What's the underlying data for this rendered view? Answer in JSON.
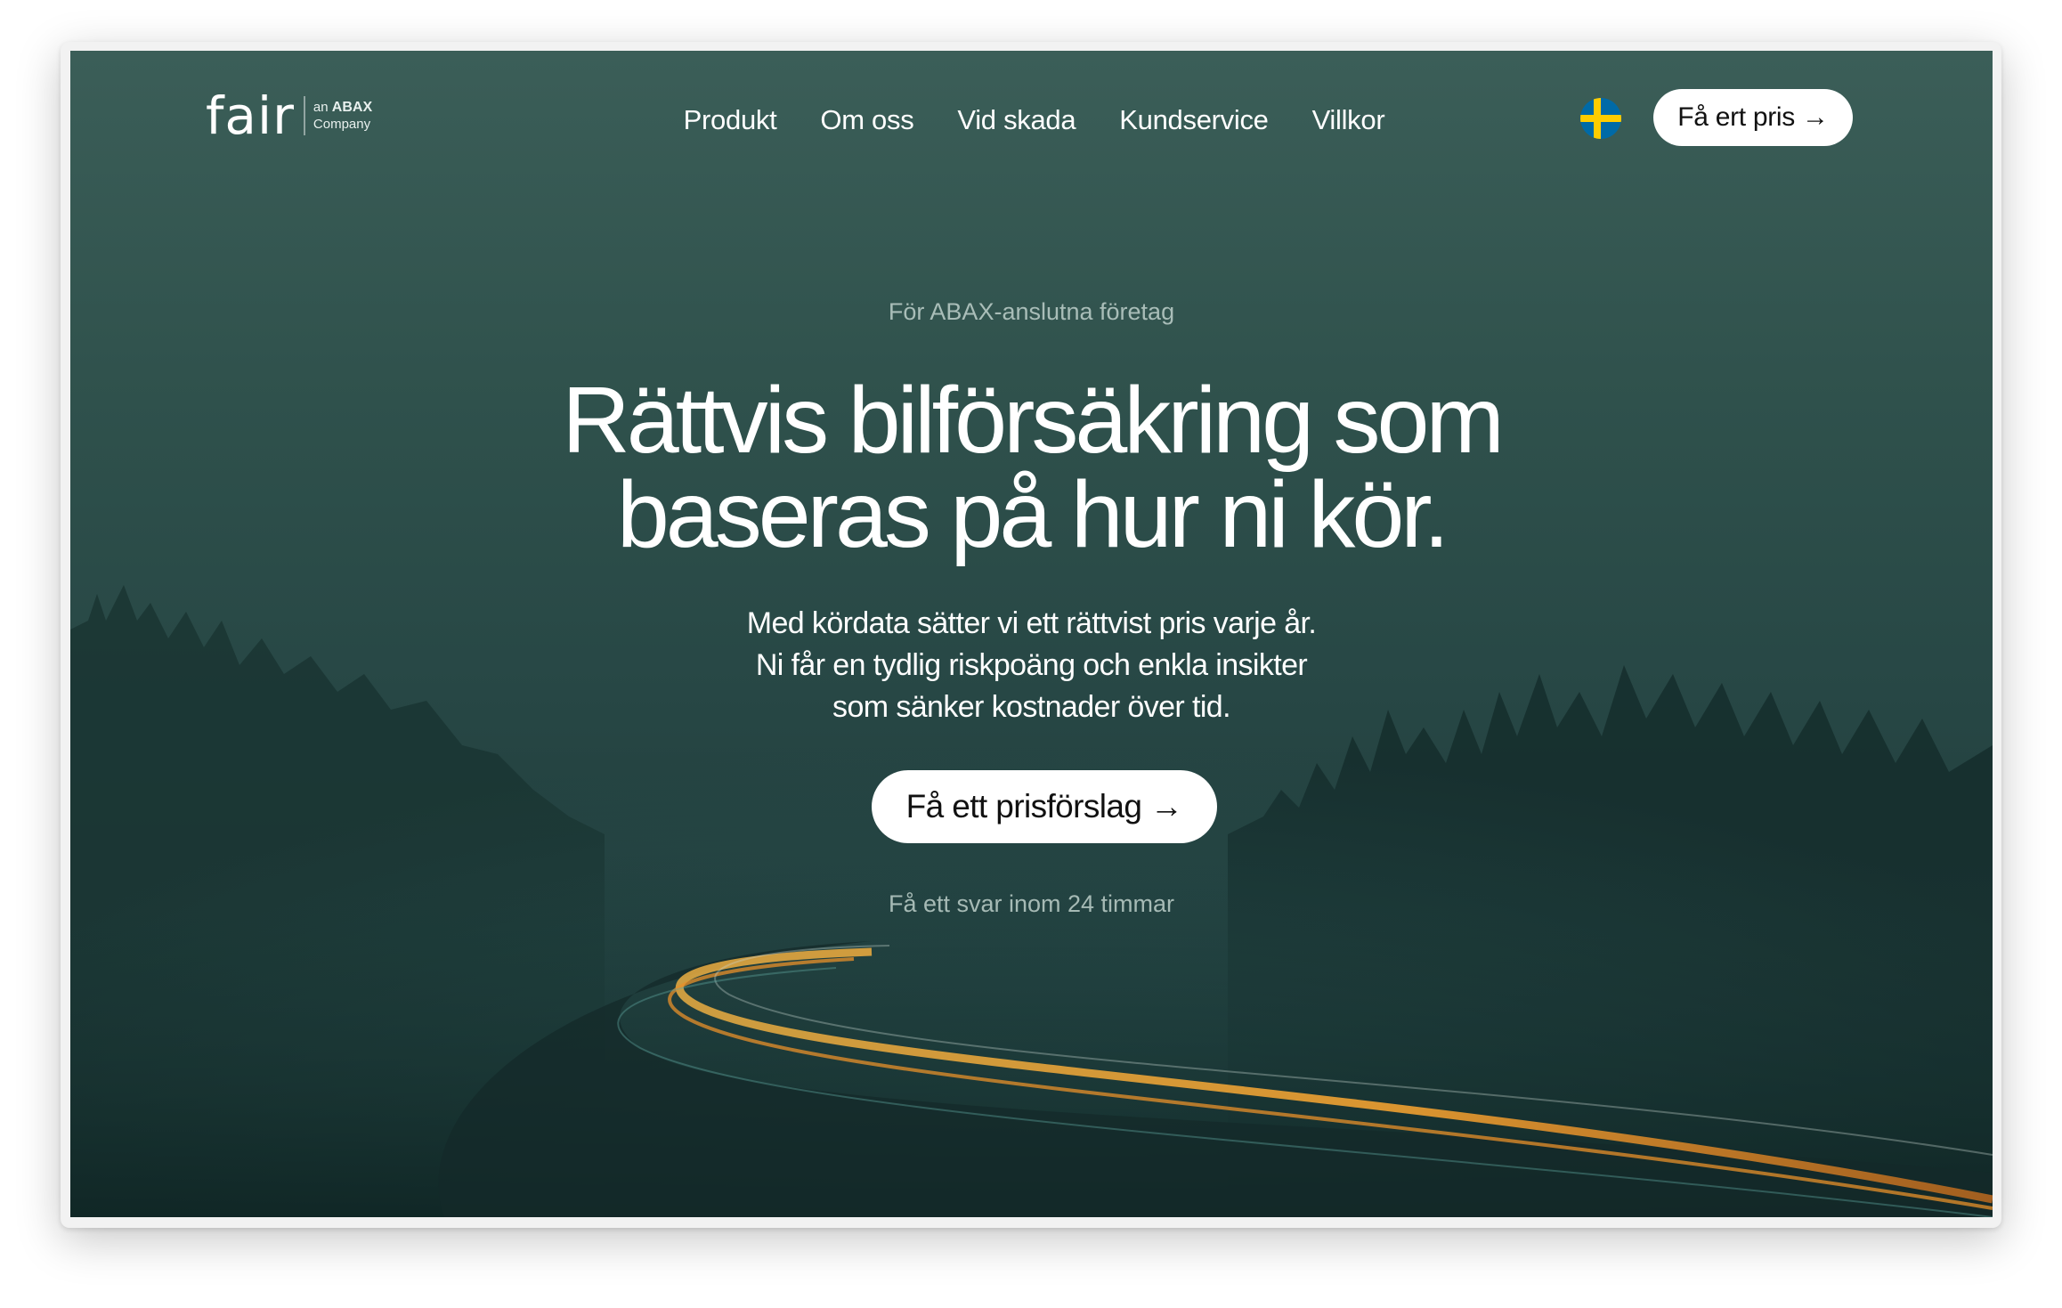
{
  "brand": {
    "logo": "fair",
    "sub_prefix": "an",
    "sub_brand": "ABAX",
    "sub_suffix": "Company"
  },
  "nav": {
    "items": [
      {
        "label": "Produkt"
      },
      {
        "label": "Om oss"
      },
      {
        "label": "Vid skada"
      },
      {
        "label": "Kundservice"
      },
      {
        "label": "Villkor"
      }
    ],
    "language_icon": "sweden-flag-icon",
    "cta_label": "Få ert pris →"
  },
  "hero": {
    "eyebrow": "För ABAX-anslutna företag",
    "headline_lines": [
      "Rättvis bilförsäkring som",
      "baseras på hur ni kör."
    ],
    "subtext_lines": [
      "Med kördata sätter vi ett rättvist pris varje år.",
      "Ni får en tydlig riskpoäng och enkla insikter",
      "som sänker kostnader över tid."
    ],
    "cta_label": "Få ett prisförslag →",
    "note": "Få ett svar inom 24 timmar"
  },
  "colors": {
    "hero_top": "#3b5e58",
    "hero_bottom": "#17302f",
    "light_trail": "#f2a53a",
    "button_bg": "#ffffff",
    "flag_blue": "#006aa7",
    "flag_yellow": "#fecc00"
  }
}
